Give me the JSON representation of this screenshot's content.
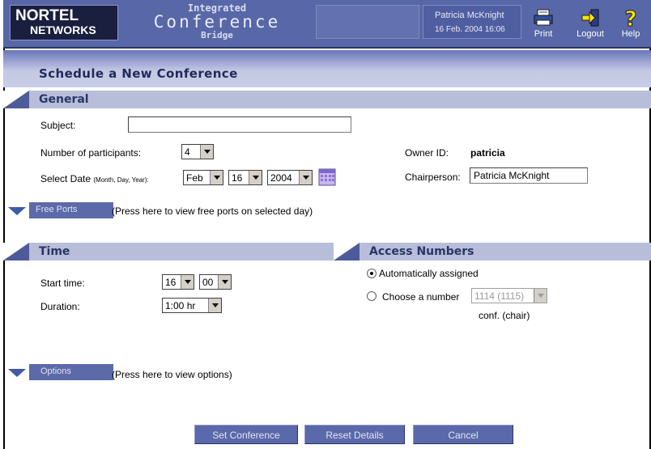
{
  "brand": {
    "line1": "NORTEL",
    "line2": "NETWORKS"
  },
  "product": {
    "line1": "Integrated",
    "line2": "Conference",
    "line3": "Bridge"
  },
  "user": {
    "name": "Patricia McKnight",
    "datetime": "16 Feb. 2004 16:06"
  },
  "toolbar": {
    "print": "Print",
    "logout": "Logout",
    "help": "Help"
  },
  "page_title": "Schedule a New Conference",
  "general": {
    "title": "General",
    "subject_label": "Subject:",
    "subject_value": "",
    "participants_label": "Number of participants:",
    "participants_value": "4",
    "date_label": "Select Date",
    "date_hint": "(Month, Day, Year):",
    "month": "Feb",
    "day": "16",
    "year": "2004",
    "owner_label": "Owner ID:",
    "owner_value": "patricia",
    "chair_label": "Chairperson:",
    "chair_value": "Patricia McKnight",
    "free_ports_button": "Free Ports",
    "free_ports_hint": "(Press here to view free ports on selected day)"
  },
  "time": {
    "title": "Time",
    "start_label": "Start time:",
    "start_hour": "16",
    "start_minute": "00",
    "duration_label": "Duration:",
    "duration_value": "1:00 hr"
  },
  "access": {
    "title": "Access Numbers",
    "auto_label": "Automatically assigned",
    "choose_label": "Choose a number",
    "number_value": "1114 (1115)",
    "number_caption": "conf. (chair)",
    "selected": "auto"
  },
  "options": {
    "button": "Options",
    "hint": "(Press here to view options)"
  },
  "actions": {
    "set": "Set Conference",
    "reset": "Reset Details",
    "cancel": "Cancel"
  },
  "colors": {
    "header_bg": "#5867a8",
    "section_bar": "#b8bed9",
    "section_text": "#2a3566",
    "button_bg": "#5a69aa"
  }
}
